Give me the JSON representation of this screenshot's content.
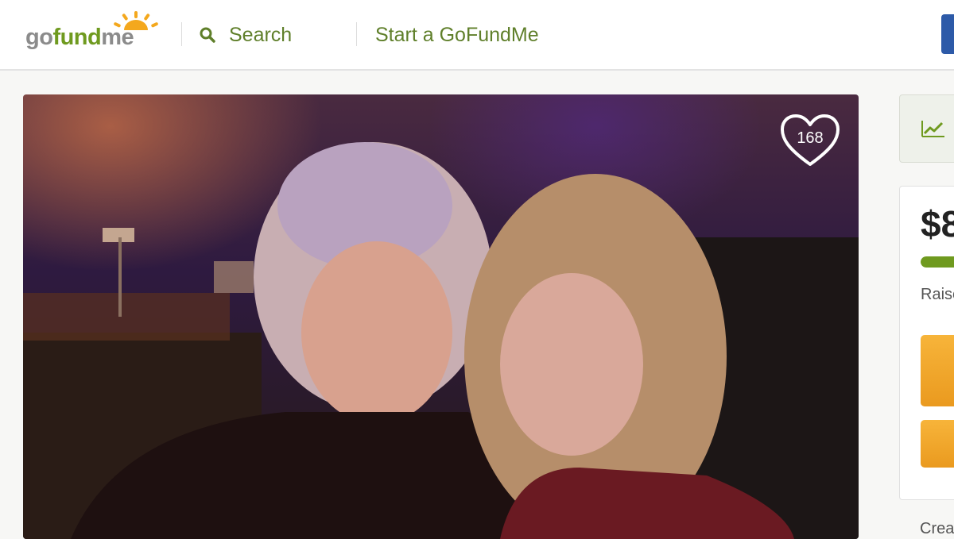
{
  "header": {
    "logo_text": {
      "go": "go",
      "fund": "fund",
      "me": "me"
    },
    "search_label": "Search",
    "search_icon": "search-icon",
    "start_label": "Start a GoFundMe"
  },
  "photo": {
    "likes_count": "168",
    "likes_icon": "heart-icon"
  },
  "sidebar": {
    "trend_icon": "trending-chart-icon",
    "amount_partial": "$8",
    "raised_partial": "Raise",
    "created_partial": "Crea"
  },
  "colors": {
    "brand_green": "#6f9a1f",
    "link_green": "#5f7f2a",
    "donate_orange": "#ea9a1f",
    "header_button_blue": "#2d5aa8"
  }
}
